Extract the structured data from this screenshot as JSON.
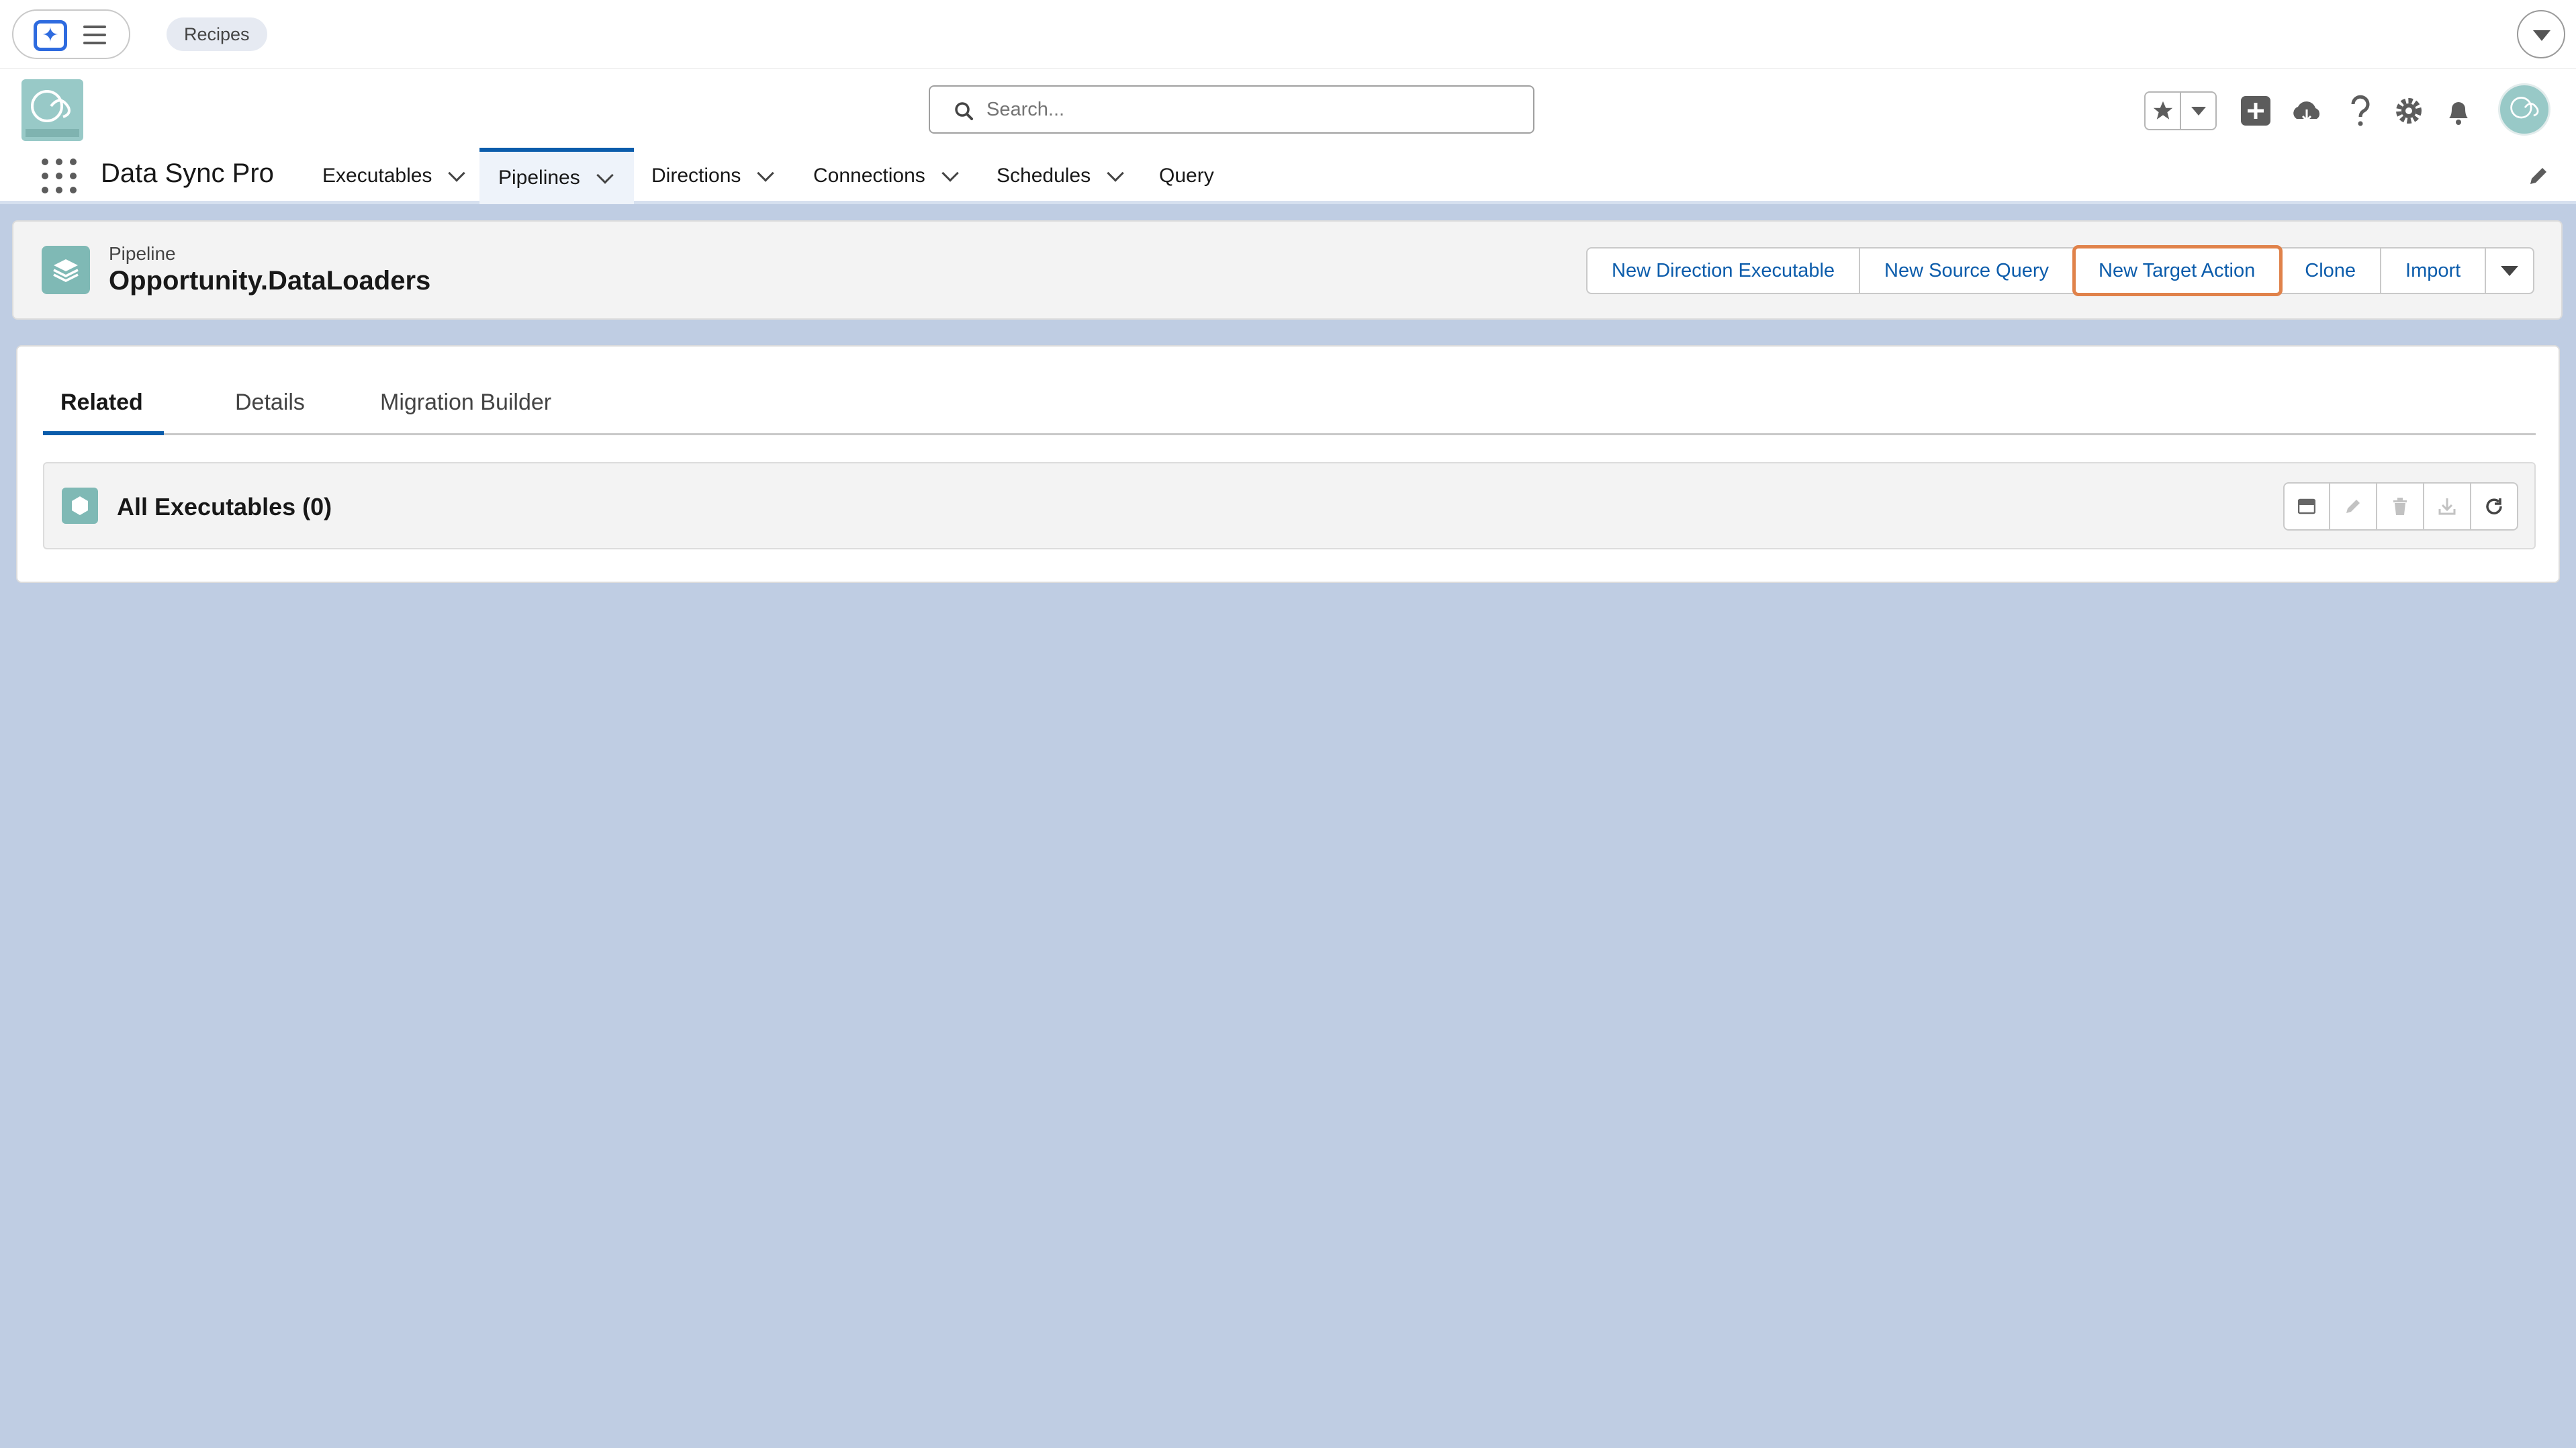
{
  "utility_bar": {
    "recipes_label": "Recipes",
    "icons": [
      "spark-icon",
      "menu-icon",
      "chevron-down-icon"
    ]
  },
  "header": {
    "logo_text": "Data Sync Pro",
    "search": {
      "placeholder": "Search..."
    },
    "icons": [
      "star-icon",
      "chevron-down-icon",
      "add-icon",
      "cloud-icon",
      "help-icon",
      "settings-icon",
      "bell-icon",
      "avatar"
    ]
  },
  "nav": {
    "app_name": "Data Sync Pro",
    "items": [
      {
        "label": "Executables",
        "has_menu": true,
        "active": false
      },
      {
        "label": "Pipelines",
        "has_menu": true,
        "active": true
      },
      {
        "label": "Directions",
        "has_menu": true,
        "active": false
      },
      {
        "label": "Connections",
        "has_menu": true,
        "active": false
      },
      {
        "label": "Schedules",
        "has_menu": true,
        "active": false
      },
      {
        "label": "Query",
        "has_menu": false,
        "active": false
      }
    ]
  },
  "record": {
    "type_label": "Pipeline",
    "title": "Opportunity.DataLoaders",
    "actions": [
      "New Direction Executable",
      "New Source Query",
      "New Target Action",
      "Clone",
      "Import"
    ],
    "focused_action": "New Target Action"
  },
  "tabs": {
    "items": [
      "Related",
      "Details",
      "Migration Builder"
    ],
    "active": "Related"
  },
  "related_list": {
    "title": "All Executables (0)",
    "tools": [
      "list-view-icon",
      "edit-icon",
      "delete-icon",
      "download-icon",
      "refresh-icon"
    ]
  },
  "colors": {
    "page_bg": "#bfcde3",
    "brand_blue": "#0b5cab",
    "focus_ring": "#e0824a",
    "teal_icon": "#7fb9b5"
  }
}
